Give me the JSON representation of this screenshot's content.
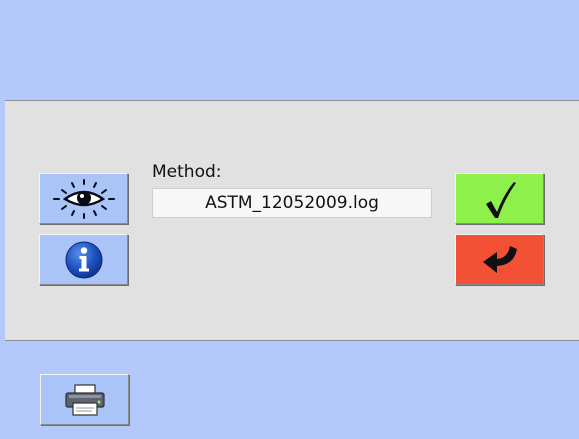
{
  "top_bar": {},
  "method": {
    "label": "Method:",
    "value": "ASTM_12052009.log"
  },
  "buttons": {
    "view_icon": "eye-icon",
    "info_icon": "info-icon",
    "confirm_icon": "checkmark-icon",
    "back_icon": "return-arrow-icon",
    "print_icon": "printer-icon"
  },
  "colors": {
    "band": "#b3c9fb",
    "panel": "#e1e1e1",
    "blue_button": "#aac4f8",
    "confirm_button": "#8ef04a",
    "back_button": "#f25135"
  }
}
